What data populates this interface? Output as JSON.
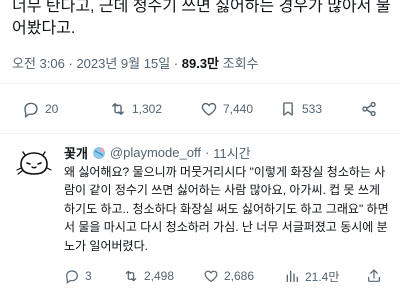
{
  "tweet": {
    "text": "너무 탄다고, 근데 청수기 쓰면 싫어하는 경우가 많아서 물어봤다고.",
    "time": "오전 3:06",
    "sep": "·",
    "date": "2023년 9월 15일",
    "views_count": "89.3만",
    "views_label": "조회수"
  },
  "actions": {
    "replies": "20",
    "retweets": "1,302",
    "likes": "7,440",
    "bookmarks": "533"
  },
  "reply": {
    "name": "꽃개",
    "handle": "@playmode_off",
    "sep": "·",
    "time": "11시간",
    "text": "왜 싫어해요? 물으니까 머뭇거리시다 \"이렇게 화장실 청소하는 사람이 같이 정수기 쓰면 싫어하는 사람 많아요, 아가씨. 컵 못 쓰게 하기도 하고.. 청소하다 화장실 써도 싫어하기도 하고 그래요\" 하면서 물을 마시고 다시 청소하러 가심. 난 너무 서글퍼졌고 동시에 분노가 일어버렸다.",
    "actions": {
      "replies": "3",
      "retweets": "2,498",
      "likes": "2,686",
      "views": "21.4만"
    }
  },
  "colors": {
    "text": "#0f1419",
    "muted": "#536471",
    "divider": "#eff3f4"
  }
}
